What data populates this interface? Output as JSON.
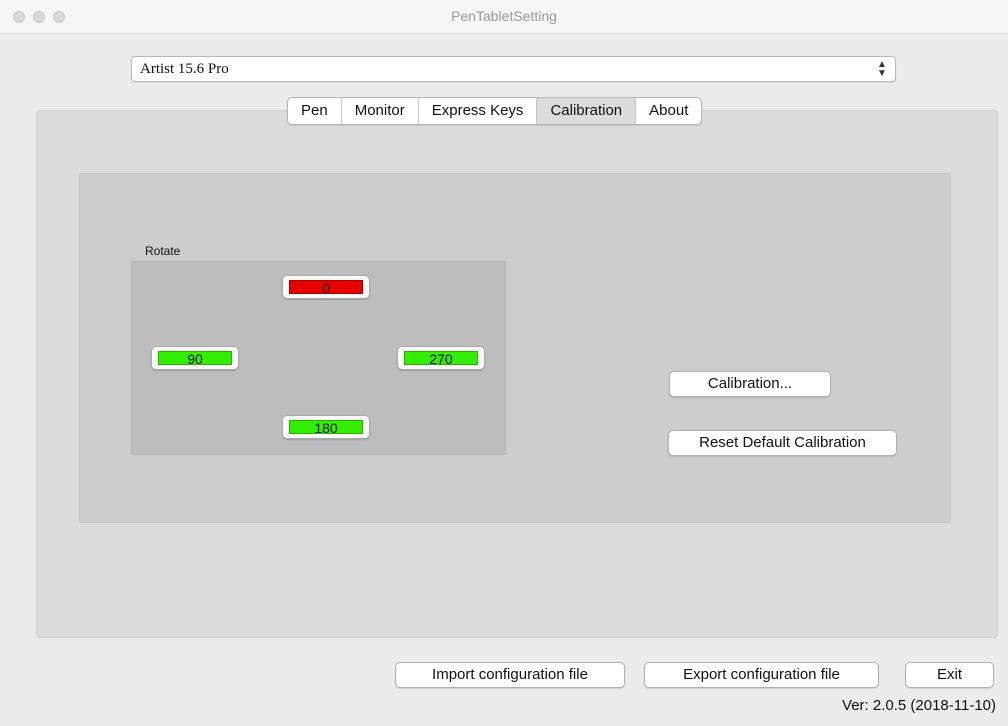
{
  "window": {
    "title": "PenTabletSetting"
  },
  "device_select": {
    "value": "Artist 15.6 Pro",
    "arrow_icon": "updown-chevron-icon"
  },
  "tabs": [
    {
      "label": "Pen",
      "active": false
    },
    {
      "label": "Monitor",
      "active": false
    },
    {
      "label": "Express Keys",
      "active": false
    },
    {
      "label": "Calibration",
      "active": true
    },
    {
      "label": "About",
      "active": false
    }
  ],
  "rotate": {
    "label": "Rotate",
    "buttons": [
      {
        "value": "0",
        "color": "#e60000",
        "selected": true
      },
      {
        "value": "90",
        "color": "#33ee00",
        "selected": false
      },
      {
        "value": "270",
        "color": "#33ee00",
        "selected": false
      },
      {
        "value": "180",
        "color": "#33ee00",
        "selected": false
      }
    ]
  },
  "calibration": {
    "calibrate_label": "Calibration...",
    "reset_label": "Reset Default Calibration"
  },
  "footer": {
    "import_label": "Import configuration file",
    "export_label": "Export configuration file",
    "exit_label": "Exit",
    "version": "Ver: 2.0.5 (2018-11-10)"
  }
}
